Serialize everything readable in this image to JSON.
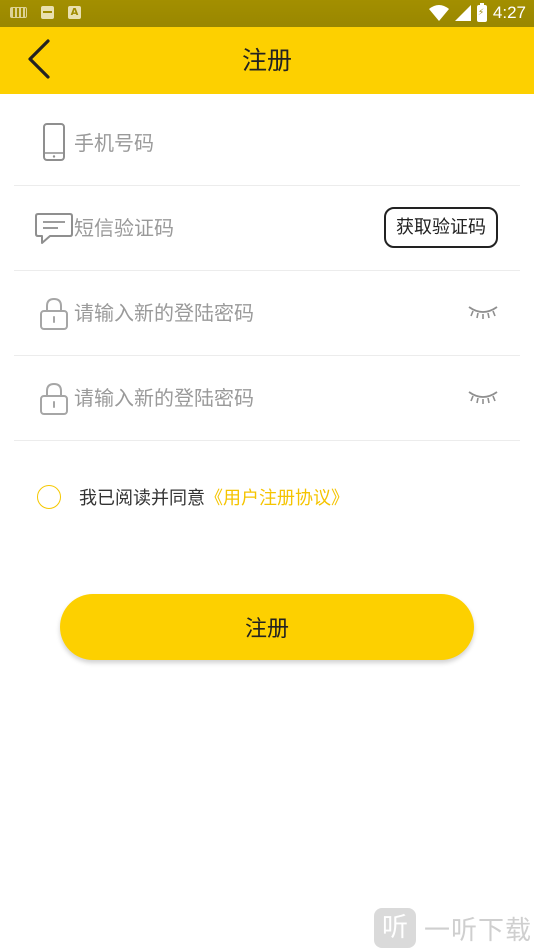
{
  "status_bar": {
    "time": "4:27",
    "battery_label": "⚡"
  },
  "header": {
    "title": "注册",
    "back_icon": "chevron-left-icon"
  },
  "form": {
    "phone": {
      "placeholder": "手机号码",
      "value": "",
      "icon": "phone-icon"
    },
    "sms_code": {
      "placeholder": "短信验证码",
      "value": "",
      "icon": "message-icon",
      "button_label": "获取验证码"
    },
    "password": {
      "placeholder": "请输入新的登陆密码",
      "value": "",
      "icon": "lock-icon",
      "toggle_icon": "eye-closed-icon"
    },
    "password_confirm": {
      "placeholder": "请输入新的登陆密码",
      "value": "",
      "icon": "lock-icon",
      "toggle_icon": "eye-closed-icon"
    }
  },
  "agreement": {
    "text": "我已阅读并同意",
    "link": "《用户注册协议》",
    "checked": false
  },
  "submit_label": "注册",
  "watermark": {
    "logo_char": "听",
    "text": "一听下载"
  },
  "colors": {
    "accent": "#fdd000",
    "status_bar": "#9a8a00",
    "link": "#f5c400",
    "checkbox_border": "#f5c800"
  }
}
